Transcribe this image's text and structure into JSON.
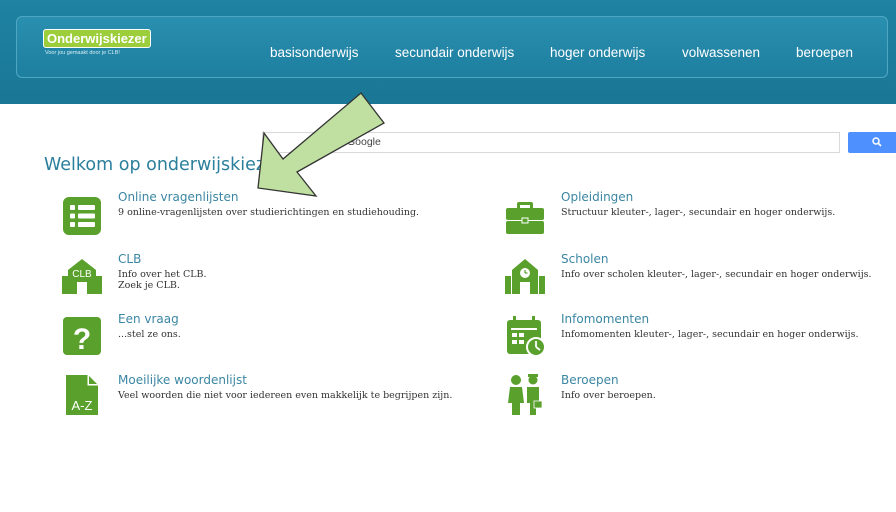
{
  "brand": {
    "logo_title": "Onderwijskiezer",
    "logo_tagline": "Voor jou gemaakt door je CLB!"
  },
  "nav": [
    {
      "label": "basisonderwijs"
    },
    {
      "label": "secundair onderwijs"
    },
    {
      "label": "hoger onderwijs"
    },
    {
      "label": "volwassenen"
    },
    {
      "label": "beroepen"
    }
  ],
  "search": {
    "brand_label": "Google",
    "value": ""
  },
  "page_title": "Welkom op onderwijskiezer",
  "items": [
    {
      "title": "Online vragenlijsten",
      "desc1": "9 online-vragenlijsten over studierichtingen en studiehouding.",
      "desc2": "",
      "icon": "list-icon"
    },
    {
      "title": "Opleidingen",
      "desc1": "Structuur kleuter-, lager-, secundair en hoger onderwijs.",
      "desc2": "",
      "icon": "briefcase-icon"
    },
    {
      "title": "CLB",
      "desc1": "Info over het CLB.",
      "desc2": "Zoek je CLB.",
      "icon": "clb-building-icon"
    },
    {
      "title": "Scholen",
      "desc1": "Info over scholen kleuter-, lager-, secundair en hoger onderwijs.",
      "desc2": "",
      "icon": "school-building-icon"
    },
    {
      "title": "Een vraag",
      "desc1": "...stel ze ons.",
      "desc2": "",
      "icon": "question-icon"
    },
    {
      "title": "Infomomenten",
      "desc1": "Infomomenten kleuter-, lager-, secundair en hoger onderwijs.",
      "desc2": "",
      "icon": "calendar-clock-icon"
    },
    {
      "title": "Moeilijke woordenlijst",
      "desc1": "Veel woorden die niet voor iedereen even makkelijk te begrijpen zijn.",
      "desc2": "",
      "icon": "a-z-document-icon"
    },
    {
      "title": "Beroepen",
      "desc1": "Info over beroepen.",
      "desc2": "",
      "icon": "professionals-icon"
    }
  ],
  "icon_glyphs": {
    "clb_text": "CLB",
    "az_text": "A-Z",
    "question_text": "?"
  },
  "colors": {
    "header": "#1f82a3",
    "icon_green": "#5aa02c",
    "logo_green": "#9ccd3b",
    "link_blue": "#3b86a3",
    "search_button": "#4d90fe",
    "arrow_fill": "#bfe0a0"
  }
}
